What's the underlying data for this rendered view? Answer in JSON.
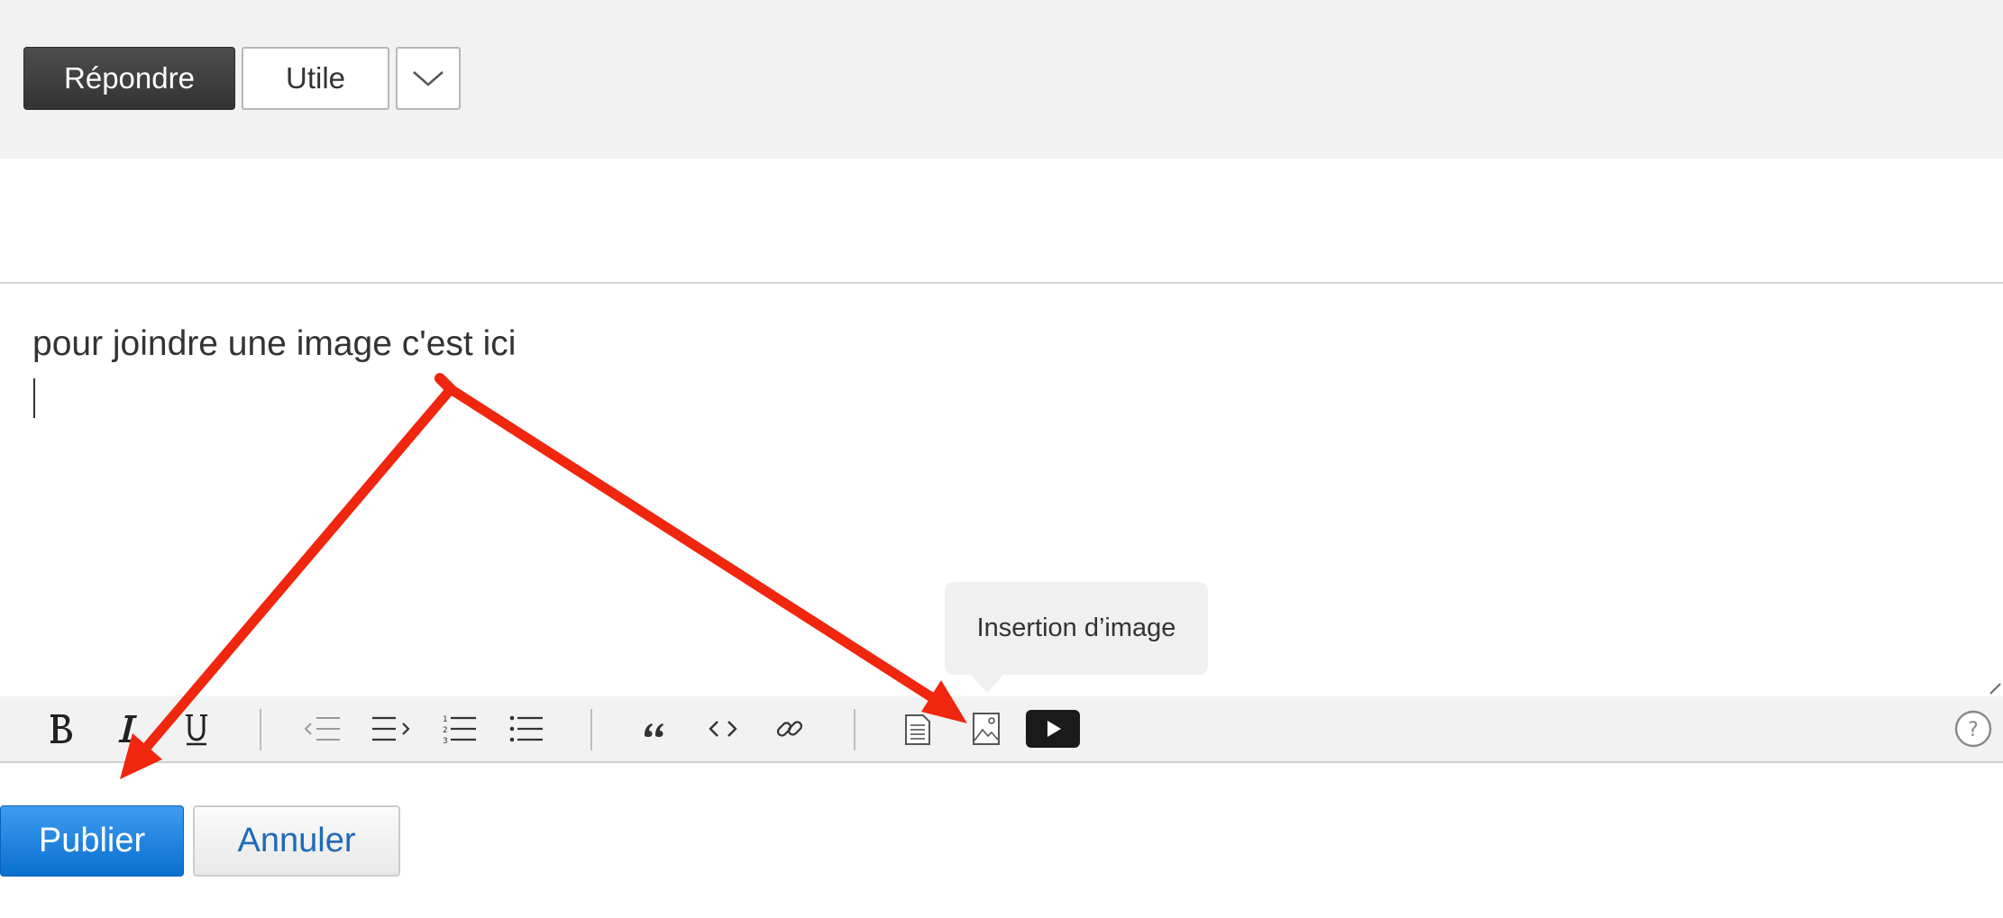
{
  "actions": {
    "reply_label": "Répondre",
    "useful_label": "Utile"
  },
  "editor": {
    "content": "pour joindre une image c'est ici"
  },
  "tooltip": {
    "text": "Insertion d’image"
  },
  "toolbar": {
    "icons": [
      "bold-icon",
      "italic-icon",
      "underline-icon",
      "outdent-icon",
      "indent-icon",
      "numbered-list-icon",
      "bulleted-list-icon",
      "quote-icon",
      "code-icon",
      "link-icon",
      "document-icon",
      "image-icon",
      "video-icon",
      "help-icon"
    ]
  },
  "form": {
    "publish_label": "Publier",
    "cancel_label": "Annuler"
  },
  "colors": {
    "annotation_arrow": "#f0260f",
    "primary_button": "#1a7fe0",
    "link_text": "#1e6bb8"
  }
}
